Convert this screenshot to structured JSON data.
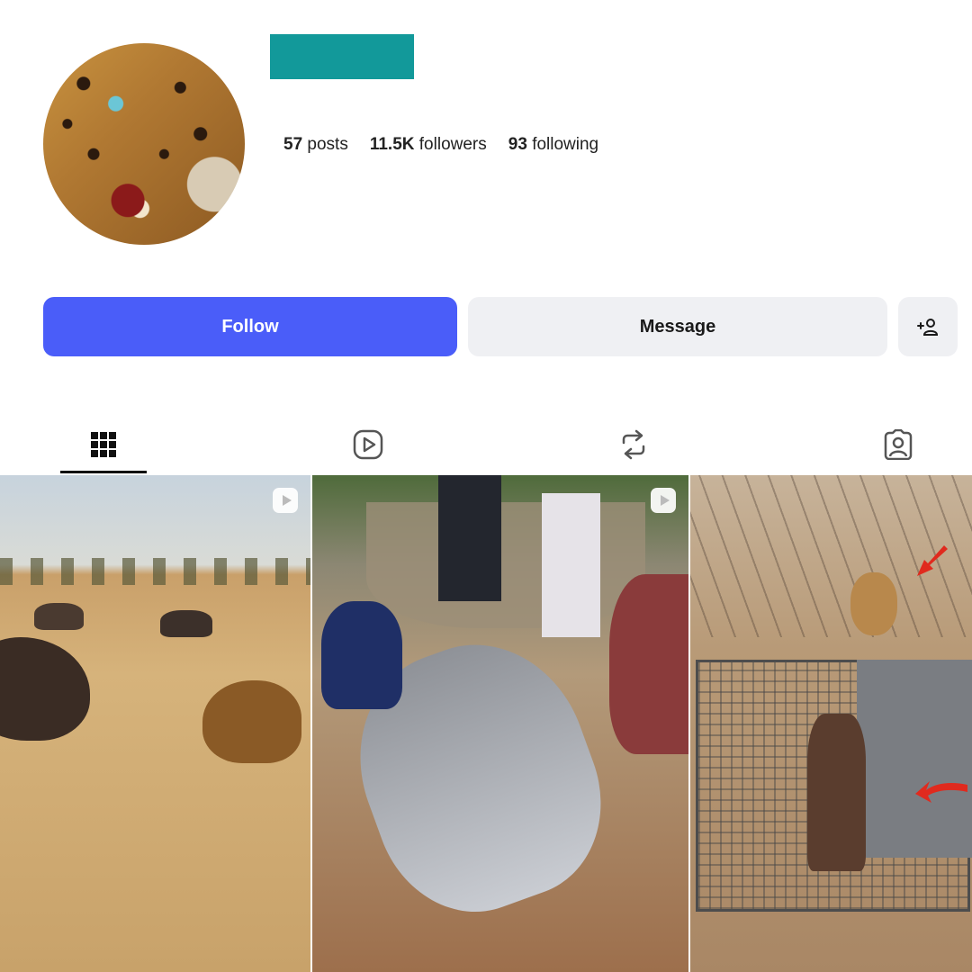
{
  "profile": {
    "stats": [
      {
        "count": "57",
        "label": "posts"
      },
      {
        "count": "11.5K",
        "label": "followers"
      },
      {
        "count": "93",
        "label": "following"
      }
    ]
  },
  "actions": {
    "follow_label": "Follow",
    "message_label": "Message",
    "add_user_icon": "person-plus-icon"
  },
  "tabs": [
    {
      "icon": "grid-icon",
      "active": true
    },
    {
      "icon": "reels-icon",
      "active": false
    },
    {
      "icon": "reposts-icon",
      "active": false
    },
    {
      "icon": "tagged-icon",
      "active": false
    }
  ],
  "posts": [
    {
      "type": "video"
    },
    {
      "type": "video"
    },
    {
      "type": "image"
    }
  ],
  "colors": {
    "accent": "#4a5df9",
    "username_placeholder": "#12999a",
    "button_secondary": "#eff0f3"
  }
}
